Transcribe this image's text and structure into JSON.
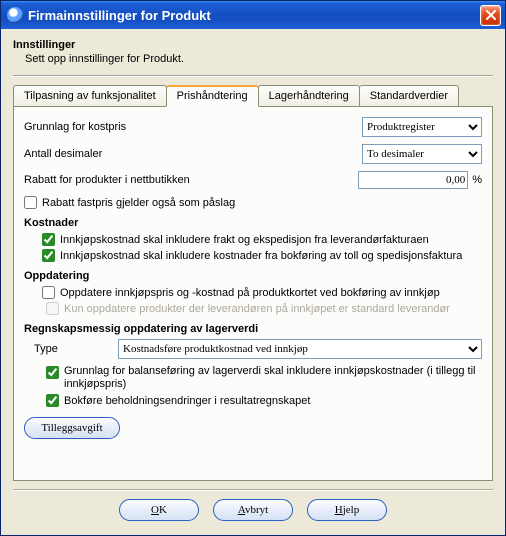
{
  "window": {
    "title": "Firmainnstillinger for Produkt"
  },
  "header": {
    "title": "Innstillinger",
    "subtitle": "Sett opp innstillinger for Produkt."
  },
  "tabs": {
    "t1": "Tilpasning av funksjonalitet",
    "t2": "Prishåndtering",
    "t3": "Lagerhåndtering",
    "t4": "Standardverdier"
  },
  "price": {
    "grunnlag_label": "Grunnlag for kostpris",
    "grunnlag_value": "Produktregister",
    "desimaler_label": "Antall desimaler",
    "desimaler_value": "To desimaler",
    "rabatt_label": "Rabatt for produkter i nettbutikken",
    "rabatt_value": "0,00",
    "pct": "%",
    "rabatt_fastpris": "Rabatt fastpris gjelder også som påslag"
  },
  "kostnader": {
    "heading": "Kostnader",
    "c1": "Innkjøpskostnad skal inkludere frakt og ekspedisjon fra leverandørfakturaen",
    "c2": "Innkjøpskostnad skal inkludere kostnader fra bokføring av toll og spedisjonsfaktura"
  },
  "oppdatering": {
    "heading": "Oppdatering",
    "c1": "Oppdatere innkjøpspris og -kostnad på produktkortet ved bokføring av innkjøp",
    "c2": "Kun oppdatere produkter der leverandøren på innkjøpet er standard leverandør"
  },
  "regnskap": {
    "heading": "Regnskapsmessig oppdatering av lagerverdi",
    "type_label": "Type",
    "type_value": "Kostnadsføre produktkostnad ved innkjøp",
    "c1": "Grunnlag for balanseføring av lagerverdi skal inkludere innkjøpskostnader (i tillegg til innkjøpspris)",
    "c2": "Bokføre beholdningsendringer i resultatregnskapet"
  },
  "buttons": {
    "tillegg": "Tilleggsavgift",
    "ok_u": "O",
    "ok_rest": "K",
    "avbryt_u": "A",
    "avbryt_rest": "vbryt",
    "hjelp_u": "H",
    "hjelp_rest": "jelp"
  }
}
